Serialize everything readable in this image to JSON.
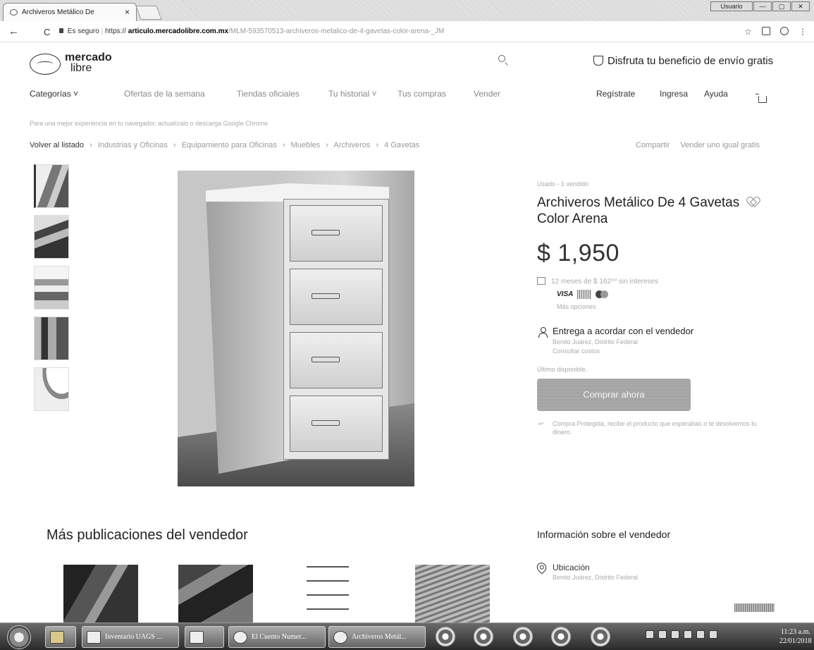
{
  "browser": {
    "tab_title": "Archiveros Metálico De",
    "tab_close": "×",
    "window_user": "Usuario",
    "win_min": "—",
    "win_max": "▢",
    "win_close": "✕",
    "secure_label": "Es seguro",
    "url_scheme": "https://",
    "url_host": "articulo.mercadolibre.com.mx",
    "url_path": "/MLM-593570513-archiveros-metalico-de-4-gavetas-color-arena-_JM",
    "back_glyph": "←",
    "reload_glyph": "C",
    "star_glyph": "☆",
    "menu_glyph": "⋮"
  },
  "header": {
    "logo_line1": "mercado",
    "logo_line2": "libre",
    "promo_text": "Disfruta tu beneficio de envío gratis",
    "nav": {
      "categories": "Categorías ˅",
      "offers": "Ofertas de la semana",
      "stores": "Tiendas oficiales",
      "history": "Tu historial ˅",
      "purchases": "Tus compras",
      "sell": "Vender"
    },
    "account": {
      "register": "Regístrate",
      "login": "Ingresa",
      "help": "Ayuda"
    },
    "notice": "Para una mejor experiencia en tu navegador, actualízalo o descarga Google Chrome"
  },
  "breadcrumb": {
    "back": "Volver al listado",
    "items": [
      "Industrias y Oficinas",
      "Equipamiento para Oficinas",
      "Muebles",
      "Archiveros",
      "4 Gavetas"
    ],
    "separator": "›",
    "share": "Compartir",
    "sell_link": "Vender uno igual gratis"
  },
  "product": {
    "condition": "Usado - 1 vendido",
    "title": "Archiveros Metálico De 4 Gavetas Color Arena",
    "price": "$ 1,950",
    "installments": "12 meses de $ 162⁵⁰ sin intereses",
    "visa": "VISA",
    "more_options": "Más opciones",
    "delivery_title": "Entrega a acordar con el vendedor",
    "delivery_location": "Benito Juárez, Distrito Federal",
    "delivery_costs": "Consultar costos",
    "stock": "Último disponible.",
    "buy_button": "Comprar ahora",
    "guarantee": "Compra Protegida, recibe el producto que esperabas o te devolvemos tu dinero."
  },
  "more_section": {
    "title": "Más publicaciones del vendedor"
  },
  "seller": {
    "title": "Información sobre el vendedor",
    "location_label": "Ubicación",
    "location_value": "Benito Juárez, Distrito Federal"
  },
  "taskbar": {
    "buttons": [
      "Inventario UAGS ...",
      "",
      "El Cuento Numer...",
      "Archiveros Metál..."
    ],
    "clock_time": "11:23 a.m.",
    "clock_date": "22/01/2018"
  }
}
